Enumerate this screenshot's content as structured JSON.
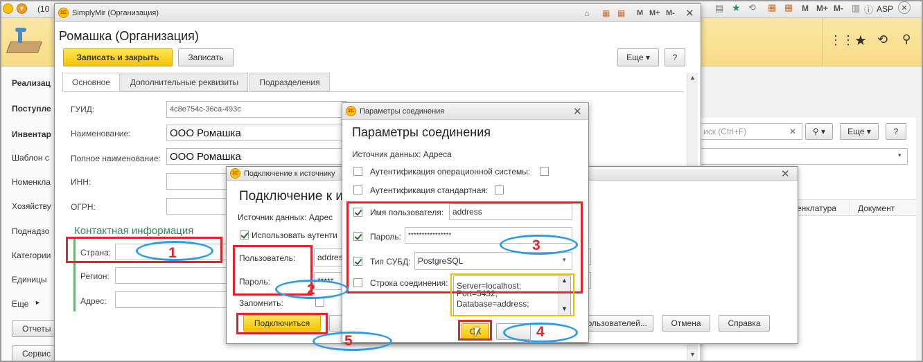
{
  "browser": {
    "tab_fragment": "(10",
    "right_icons": [
      "M",
      "M+",
      "M-"
    ],
    "user": "ASP"
  },
  "sidebar": {
    "items": [
      "Реализац",
      "Поступле",
      "Инвентар",
      "Шаблон с",
      "Номенкла",
      "Хозяйству",
      "Поднадзо",
      "Категории",
      "Единицы",
      "Еще"
    ],
    "buttons": [
      "Отчеты",
      "Сервис"
    ]
  },
  "background": {
    "search_placeholder": "иск (Ctrl+F)",
    "more_label": "Еще",
    "help_label": "?",
    "col_nomenclature": "енклатура",
    "col_document": "Документ",
    "btn_users": "ользователей...",
    "btn_cancel": "Отмена",
    "btn_help": "Справка"
  },
  "org_window": {
    "title": "SimplyMir (Организация)",
    "heading": "Ромашка (Организация)",
    "btn_save_close": "Записать и закрыть",
    "btn_save": "Записать",
    "btn_more": "Еще",
    "btn_help": "?",
    "tabs": [
      "Основное",
      "Дополнительные реквизиты",
      "Подразделения"
    ],
    "label_guid": "ГУИД:",
    "guid_value": "4c8e754c-36ca-493c",
    "label_name": "Наименование:",
    "name_value": "ООО Ромашка",
    "label_fullname": "Полное наименование:",
    "fullname_value": "ООО Ромашка",
    "label_inn": "ИНН:",
    "label_ogrn": "ОГРН:",
    "contact_heading": "Контактная информация",
    "label_country": "Страна:",
    "label_region": "Регион:",
    "label_address": "Адрес:"
  },
  "connect_window": {
    "title": "Подключение к источнику",
    "heading": "Подключение к и",
    "data_source": "Источник данных: Адрес",
    "use_auth": "Использовать аутенти",
    "label_user": "Пользователь:",
    "user_value": "addres",
    "label_password": "Пароль:",
    "password_value": "*****",
    "label_remember": "Запомнить:",
    "btn_connect": "Подключиться"
  },
  "params_window": {
    "title": "Параметры соединения",
    "heading": "Параметры соединения",
    "data_source": "Источник данных: Адреса",
    "os_auth": "Аутентификация операционной системы:",
    "std_auth": "Аутентификация стандартная:",
    "label_username": "Имя пользователя:",
    "username_value": "address",
    "label_password": "Пароль:",
    "password_value": "****************",
    "label_dbms": "Тип СУБД:",
    "dbms_value": "PostgreSQL",
    "label_connstring": "Строка соединения:",
    "connstring_lines": [
      "Server=localhost;",
      "Port=5432;",
      "Database=address;"
    ],
    "btn_ok": "ОК"
  },
  "annotations": {
    "n1": "1",
    "n2": "2",
    "n3": "3",
    "n4": "4",
    "n5": "5"
  },
  "colors": {
    "annotation_red": "#e0252c",
    "annotation_blue": "#2f9be3",
    "accent_yellow": "#f5c400",
    "contact_green": "#2e8b57"
  }
}
